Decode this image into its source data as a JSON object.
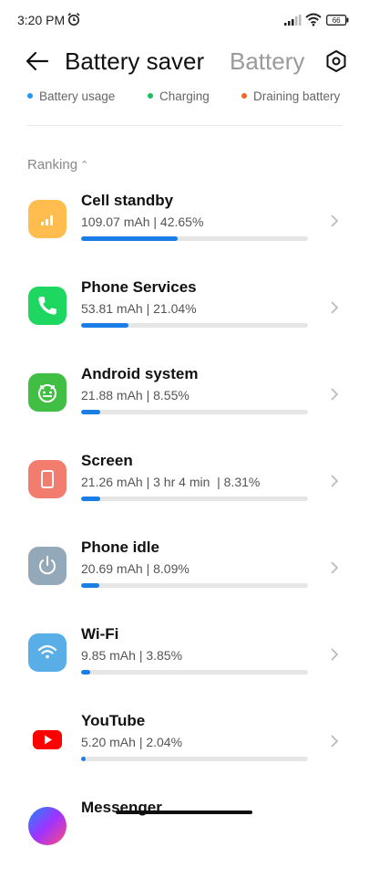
{
  "status_bar": {
    "time": "3:20 PM",
    "battery_level": "66"
  },
  "header": {
    "active_tab": "Battery saver",
    "inactive_tab": "Battery"
  },
  "legend": [
    {
      "label": "Battery usage",
      "color": "#2196f3"
    },
    {
      "label": "Charging",
      "color": "#1bc15c"
    },
    {
      "label": "Draining battery",
      "color": "#f26522"
    }
  ],
  "ranking_label": "Ranking",
  "bar_color": "#1a7ee6",
  "apps": [
    {
      "name": "Cell standby",
      "usage": "109.07 mAh | 42.65%",
      "percent": 42.65,
      "icon": "signal-icon",
      "icon_color": "#ffbd4f"
    },
    {
      "name": "Phone Services",
      "usage": "53.81 mAh | 21.04%",
      "percent": 21.04,
      "icon": "phone-icon",
      "icon_color": "#1ed760"
    },
    {
      "name": "Android system",
      "usage": "21.88 mAh | 8.55%",
      "percent": 8.55,
      "icon": "android-icon",
      "icon_color": "#41bf45"
    },
    {
      "name": "Screen",
      "usage": "21.26 mAh | 3 hr 4 min  | 8.31%",
      "percent": 8.31,
      "icon": "screen-icon",
      "icon_color": "#f27c6e"
    },
    {
      "name": "Phone idle",
      "usage": "20.69 mAh | 8.09%",
      "percent": 8.09,
      "icon": "power-icon",
      "icon_color": "#93a9ba"
    },
    {
      "name": "Wi-Fi",
      "usage": "9.85 mAh | 3.85%",
      "percent": 3.85,
      "icon": "wifi-icon",
      "icon_color": "#5aaee8"
    },
    {
      "name": "YouTube",
      "usage": "5.20 mAh | 2.04%",
      "percent": 2.04,
      "icon": "youtube-icon",
      "icon_color": "#ff0000"
    },
    {
      "name": "Messenger",
      "usage": "",
      "percent": 0,
      "icon": "messenger-icon",
      "icon_color": "#a033ff"
    }
  ]
}
